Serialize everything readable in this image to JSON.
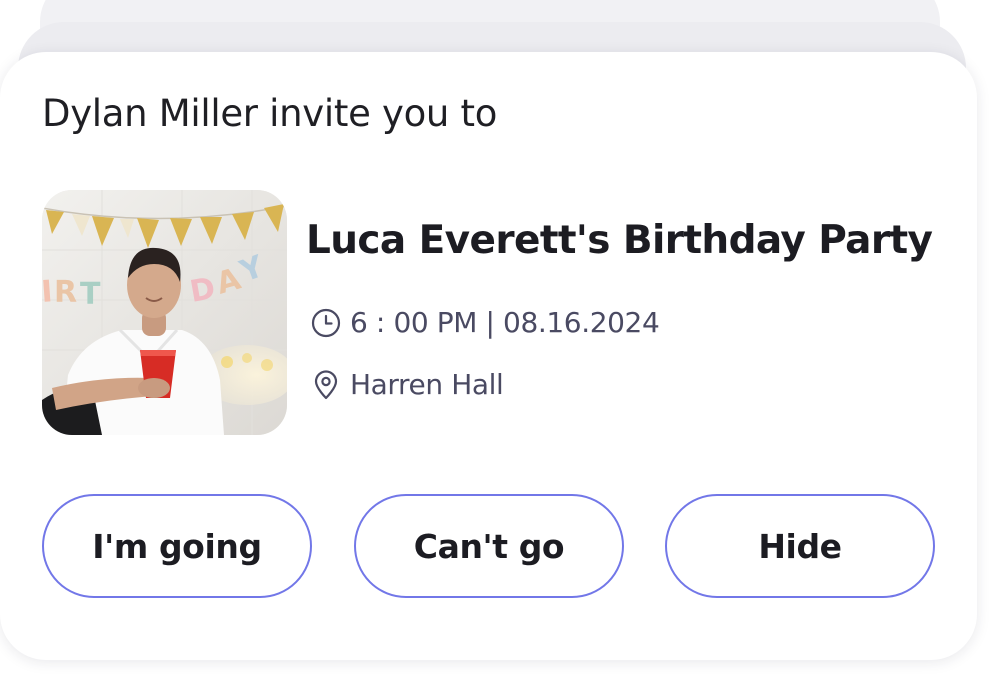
{
  "invite": {
    "text": "Dylan Miller invite you to"
  },
  "event": {
    "title": "Luca Everett's Birthday Party",
    "datetime": "6 : 00 PM | 08.16.2024",
    "location": "Harren Hall",
    "photo_banner_text": "BIRTHDAY"
  },
  "actions": {
    "going_label": "I'm going",
    "cant_go_label": "Can't go",
    "hide_label": "Hide"
  },
  "icons": {
    "time": "clock-icon",
    "location": "map-pin-icon"
  },
  "colors": {
    "button_border": "#7277e8",
    "meta_text": "#4a4a62",
    "title_text": "#1c1c22"
  }
}
